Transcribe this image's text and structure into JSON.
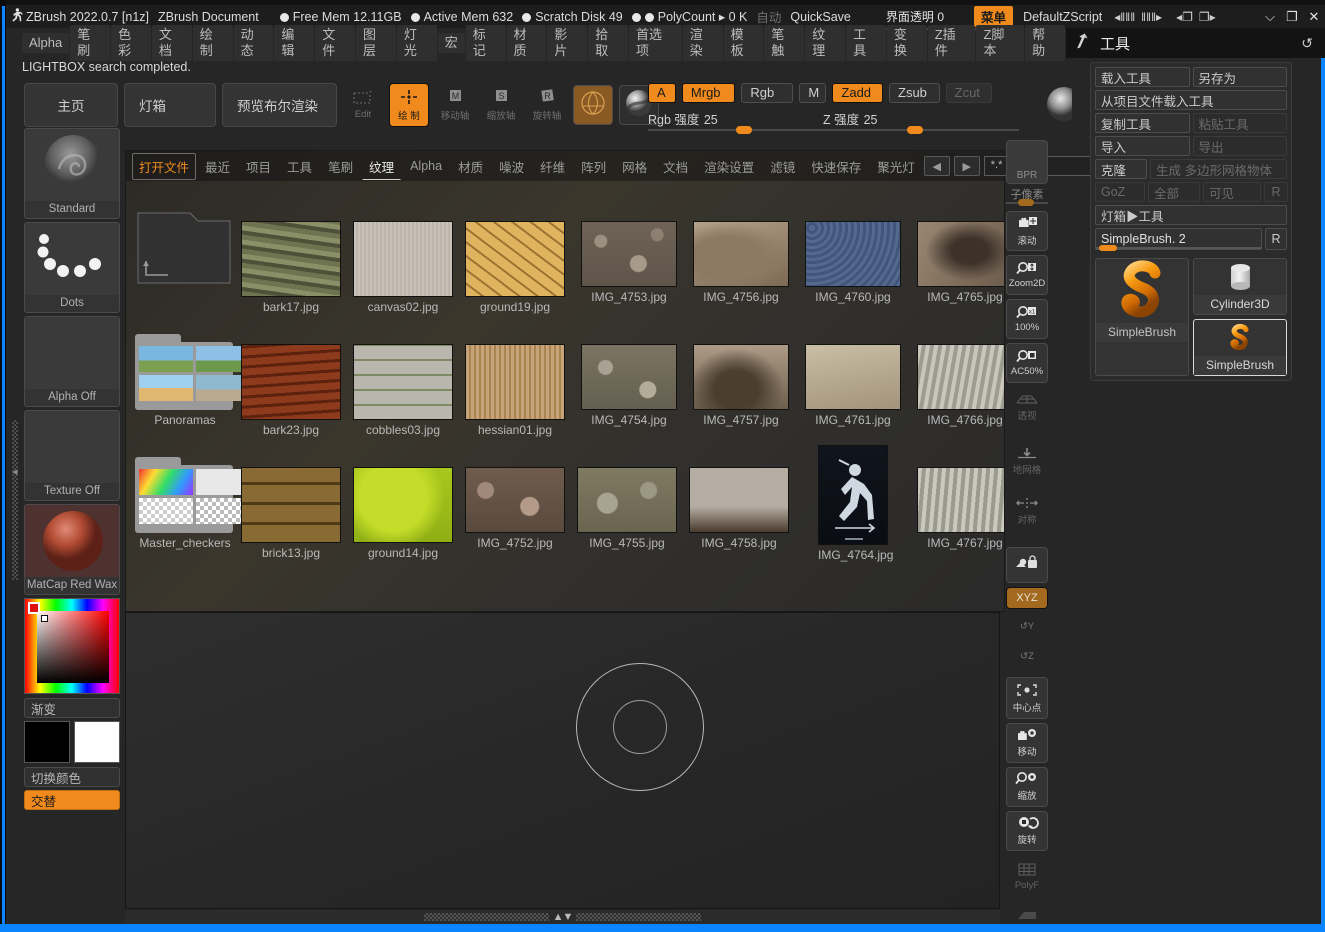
{
  "titlebar": {
    "logo_icon": "zbrush-runner-icon",
    "app_version": "ZBrush 2022.0.7 [n1z]",
    "document_name": "ZBrush Document",
    "free_mem": "Free Mem 12.11GB",
    "active_mem": "Active Mem 632",
    "scratch_disk": "Scratch Disk 49",
    "polycount": "PolyCount ▸ 0 K",
    "auto": "自动",
    "quicksave": "QuickSave",
    "ui_transparency_label": "界面透明",
    "ui_transparency_value": "0",
    "menu_button": "菜单",
    "default_zscript": "DefaultZScript",
    "arrows_left": "◂‖‖‖",
    "arrows_right": "‖‖‖▸",
    "win_minimize": "⌵",
    "win_restore": "❐",
    "win_close": "✕"
  },
  "menubar": {
    "items": [
      "Alpha",
      "笔刷",
      "色彩",
      "文档",
      "绘制",
      "动态",
      "编辑",
      "文件",
      "图层",
      "灯光",
      "宏",
      "标记",
      "材质",
      "影片",
      "拾取",
      "首选项",
      "渲染",
      "模板",
      "笔触",
      "纹理",
      "工具",
      "变换",
      "Z插件",
      "Z脚本",
      "帮助"
    ]
  },
  "right_panel_header": {
    "icon": "hammer-icon",
    "title": "工具",
    "refresh_icon": "↺"
  },
  "status": {
    "message": "LIGHTBOX search completed."
  },
  "toptools": {
    "home": "主页",
    "lightbox": "灯箱",
    "preview_bool_render": "预览布尔渲染",
    "edit": "Edit",
    "draw": "绘 制",
    "move": "移动轴",
    "scale": "缩放轴",
    "rotate": "旋转轴",
    "material_icon": "material-sphere-icon",
    "matcap_icon": "matcap-sphere-icon"
  },
  "rgb_cluster": {
    "a": "A",
    "mrgb": "Mrgb",
    "rgb": "Rgb",
    "m": "M",
    "zadd": "Zadd",
    "zsub": "Zsub",
    "zcut": "Zcut",
    "rgb_intensity_label": "Rgb 强度",
    "rgb_intensity_value": "25",
    "z_intensity_label": "Z 强度",
    "z_intensity_value": "25"
  },
  "left_sidebar": {
    "brush": {
      "label": "Standard",
      "icon": "brush-swirl-icon"
    },
    "stroke": {
      "label": "Dots",
      "icon": "dots-stroke-icon"
    },
    "alpha": {
      "label": "Alpha Off",
      "icon": "alpha-off-icon"
    },
    "texture": {
      "label": "Texture Off",
      "icon": "texture-off-icon"
    },
    "material": {
      "label": "MatCap Red Wax",
      "icon": "matcap-red-wax-icon"
    },
    "gradient_button": "渐变",
    "switch_color_button": "切换颜色",
    "alternate_button": "交替",
    "swatch_primary": "#000000",
    "swatch_secondary": "#ffffff"
  },
  "lightbox": {
    "tabs": [
      {
        "label": "打开文件",
        "state": "accent"
      },
      {
        "label": "最近",
        "state": "normal"
      },
      {
        "label": "项目",
        "state": "normal"
      },
      {
        "label": "工具",
        "state": "normal"
      },
      {
        "label": "笔刷",
        "state": "normal"
      },
      {
        "label": "纹理",
        "state": "current"
      },
      {
        "label": "Alpha",
        "state": "normal"
      },
      {
        "label": "材质",
        "state": "normal"
      },
      {
        "label": "噪波",
        "state": "normal"
      },
      {
        "label": "纤维",
        "state": "normal"
      },
      {
        "label": "阵列",
        "state": "normal"
      },
      {
        "label": "网格",
        "state": "normal"
      },
      {
        "label": "文档",
        "state": "normal"
      },
      {
        "label": "渲染设置",
        "state": "normal"
      },
      {
        "label": "滤镜",
        "state": "normal"
      },
      {
        "label": "快速保存",
        "state": "normal"
      },
      {
        "label": "聚光灯",
        "state": "normal"
      }
    ],
    "nav_back_icon": "◀",
    "nav_forward_icon": "▶",
    "search_value": "*.*",
    "items": [
      {
        "name": "..",
        "type": "folder-up"
      },
      {
        "name": "bark17.jpg",
        "type": "image"
      },
      {
        "name": "canvas02.jpg",
        "type": "image"
      },
      {
        "name": "ground19.jpg",
        "type": "image"
      },
      {
        "name": "IMG_4753.jpg",
        "type": "image"
      },
      {
        "name": "IMG_4756.jpg",
        "type": "image"
      },
      {
        "name": "IMG_4760.jpg",
        "type": "image"
      },
      {
        "name": "IMG_4765.jpg",
        "type": "image"
      },
      {
        "name": "Panoramas",
        "type": "folder"
      },
      {
        "name": "bark23.jpg",
        "type": "image"
      },
      {
        "name": "cobbles03.jpg",
        "type": "image"
      },
      {
        "name": "hessian01.jpg",
        "type": "image"
      },
      {
        "name": "IMG_4754.jpg",
        "type": "image"
      },
      {
        "name": "IMG_4757.jpg",
        "type": "image"
      },
      {
        "name": "IMG_4761.jpg",
        "type": "image"
      },
      {
        "name": "IMG_4766.jpg",
        "type": "image"
      },
      {
        "name": "Master_checkers",
        "type": "folder"
      },
      {
        "name": "brick13.jpg",
        "type": "image"
      },
      {
        "name": "ground14.jpg",
        "type": "image"
      },
      {
        "name": "IMG_4752.jpg",
        "type": "image"
      },
      {
        "name": "IMG_4755.jpg",
        "type": "image"
      },
      {
        "name": "IMG_4758.jpg",
        "type": "image"
      },
      {
        "name": "IMG_4764.jpg",
        "type": "image"
      },
      {
        "name": "IMG_4767.jpg",
        "type": "image"
      }
    ]
  },
  "vertical_strip": {
    "bpr": "BPR",
    "subpixel_label": "子像素",
    "scroll": "滚动",
    "zoom2d": "Zoom2D",
    "actual": "100%",
    "ac50": "AC50%",
    "perspective": "透视",
    "floor": "地网格",
    "symmetry": "对称",
    "local": "local-lock-icon",
    "xyz": "XYZ",
    "y_axis": "Y",
    "z_axis": "Z",
    "center": "中心点",
    "move": "移动",
    "zoom": "缩放",
    "rotate": "旋转",
    "polyf": "PolyF"
  },
  "tool_palette": {
    "load_tool": "载入工具",
    "save_as": "另存为",
    "load_from_project": "从项目文件载入工具",
    "copy_tool": "复制工具",
    "paste_tool": "粘贴工具",
    "import": "导入",
    "export": "导出",
    "clone": "克隆",
    "make_polymesh": "生成 多边形网格物体",
    "goz": "GoZ",
    "all": "全部",
    "visible": "可见",
    "r_btn": "R",
    "lightbox_tool": "灯箱▶工具",
    "slider_label": "SimpleBrush. 2",
    "slider_r": "R",
    "big_item": {
      "label": "SimpleBrush",
      "icon": "simplebrush-s-icon"
    },
    "items": [
      {
        "label": "Cylinder3D",
        "icon": "cylinder3d-icon",
        "selected": false
      },
      {
        "label": "SimpleBrush",
        "icon": "simplebrush-s-icon",
        "selected": true
      }
    ]
  },
  "canvas": {
    "gizmo_outer_icon": "rotate-gizmo-outer",
    "gizmo_inner_icon": "rotate-gizmo-inner",
    "scroll_arrows": "▲▼"
  },
  "colors": {
    "accent": "#f08a1c",
    "accent_dark": "#a2691f",
    "panel_bg": "#2b2b2b",
    "title_bg": "#1d1d1d",
    "edge_blue": "#0a84ff",
    "text": "#c8c8c8"
  }
}
